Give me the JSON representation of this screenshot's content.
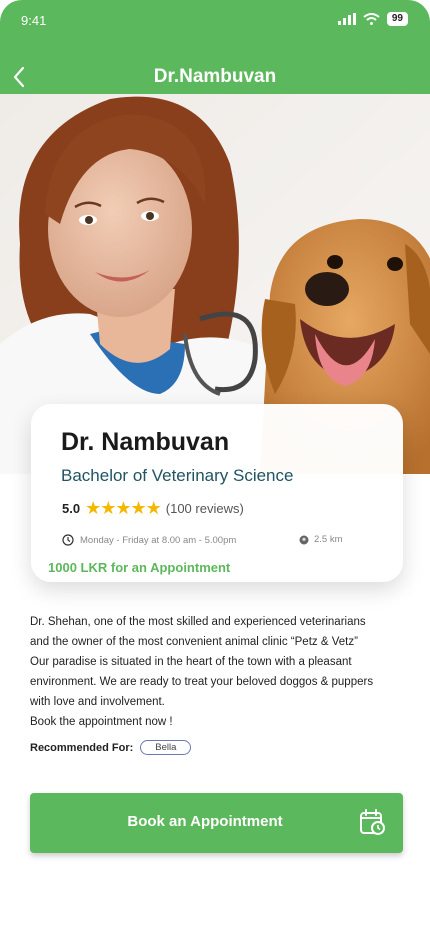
{
  "status_bar": {
    "time": "9:41",
    "battery": "99"
  },
  "header": {
    "title": "Dr.Nambuvan"
  },
  "doctor": {
    "name": "Dr. Nambuvan",
    "degree": "Bachelor of Veterinary Science",
    "rating": "5.0",
    "stars": "★★★★★",
    "reviews": "(100 reviews)",
    "hours": "Monday - Friday at 8.00 am - 5.00pm",
    "distance": "2.5 km",
    "price": "1000 LKR for an Appointment"
  },
  "description": {
    "lines": [
      "Dr. Shehan, one of the most skilled and experienced veterinarians",
      "and the owner of the most convenient animal clinic “Petz & Vetz”",
      "Our paradise is situated in the heart of the town with a pleasant",
      "environment. We are ready to treat your beloved doggos & puppers",
      "with love and involvement.",
      "Book the appointment now !"
    ]
  },
  "recommended": {
    "label": "Recommended For:",
    "tags": [
      "Bella"
    ]
  },
  "cta": {
    "label": "Book an Appointment"
  },
  "colors": {
    "primary": "#5cb85c",
    "degree": "#1f5460",
    "star": "#f5b800"
  },
  "icons": [
    "back-arrow-icon",
    "signal-icon",
    "wifi-icon",
    "clock-icon",
    "location-icon",
    "calendar-icon"
  ]
}
